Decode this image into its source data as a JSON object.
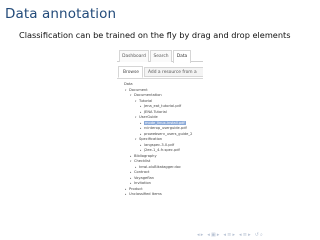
{
  "slide": {
    "title": "Data annotation",
    "subtitle": "Classification can be trained on the fly by drag and drop elements"
  },
  "app": {
    "top_tabs": [
      "Dashboard",
      "Search",
      "Data"
    ],
    "active_top_tab": "Data",
    "sub_tabs": {
      "browse": "Browse",
      "add": "Add a resource from a"
    }
  },
  "tree": [
    {
      "label": "Data",
      "depth": 0,
      "expanded": true
    },
    {
      "label": "Document",
      "depth": 1,
      "expanded": true
    },
    {
      "label": "Documentation",
      "depth": 2,
      "expanded": true
    },
    {
      "label": "Tutorial",
      "depth": 3,
      "expanded": true
    },
    {
      "label": "Jena_eat_tutorial.pdf",
      "depth": 4,
      "expanded": false
    },
    {
      "label": "JENA Tutorial",
      "depth": 4,
      "expanded": false
    },
    {
      "label": "UserGuide",
      "depth": 3,
      "expanded": true
    },
    {
      "label": "mode_linux-install.pdf",
      "depth": 4,
      "expanded": false,
      "selected": true
    },
    {
      "label": "rcinterop_userguide.pdf",
      "depth": 4,
      "expanded": false
    },
    {
      "label": "prowebserv_users_guide_2",
      "depth": 4,
      "expanded": false
    },
    {
      "label": "Specification",
      "depth": 3,
      "expanded": true
    },
    {
      "label": "langspec-3.0.pdf",
      "depth": 4,
      "expanded": false
    },
    {
      "label": "j2ee-1_4-fr-spec.pdf",
      "depth": 4,
      "expanded": false
    },
    {
      "label": "Bibliography",
      "depth": 2,
      "expanded": false
    },
    {
      "label": "Checklist",
      "depth": 2,
      "expanded": true
    },
    {
      "label": "knwl-oluBikatagger.doc",
      "depth": 3,
      "expanded": false
    },
    {
      "label": "Contract",
      "depth": 2,
      "expanded": false
    },
    {
      "label": "Voyageflan",
      "depth": 2,
      "expanded": false
    },
    {
      "label": "Invitation",
      "depth": 2,
      "expanded": false
    },
    {
      "label": "Product",
      "depth": 1,
      "expanded": false
    },
    {
      "label": "Unclassified Items",
      "depth": 1,
      "expanded": false
    }
  ],
  "icons": {
    "expanded": "triangle-down-icon",
    "collapsed": "triangle-right-icon"
  },
  "colors": {
    "title": "#234b7a",
    "selection": "#8aa9d8",
    "nav": "#b7c2d3"
  }
}
